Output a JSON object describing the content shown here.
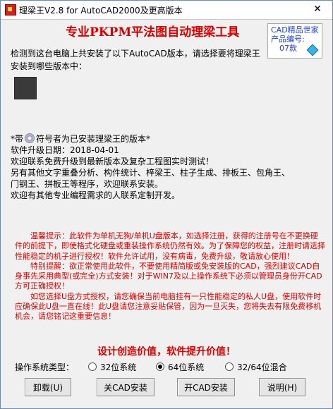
{
  "window": {
    "title": "理梁王V2.8 for AutoCAD2000及更高版本",
    "close_glyph": "✕"
  },
  "header": {
    "headline": "专业PKPM平法图自动理梁工具",
    "product_box": {
      "line1": "CAD精品世家",
      "line2": "产品编号:",
      "line3": "07款"
    }
  },
  "detect": {
    "message": "检测到这台电脑上共安装了以下AutoCAD版本，请选择要将理梁王安装到哪些版本中："
  },
  "info": {
    "installed_note_prefix": "*带",
    "installed_note_suffix": "符号者为已安装理梁王的版本*",
    "upgrade_date": "软件升级日期：2018-04-01",
    "line3": "欢迎联系免费升级到最新版本及复杂工程图实时测试！",
    "line4": "另有其他文字重叠分析、构件统计、梓梁王、柱子生成、排板王、包角王、",
    "line5": "门钢王、拼板王等程序，欢迎联系安装。",
    "line6": "欢迎有其他专业编程需求的人联系定制开发。"
  },
  "notice": {
    "p1": "温馨提示：此软件为单机无狗/单机U盘版本，如选择注册，获得的注册号在不更换硬件的前提下，即使格式化硬盘或重装操作系统仍然有效。为了保障您的权益，注册时请选择性能稳定的机子进行授权！软件允许试用，没有病毒，免费升级，敬请放心使用！",
    "p2": "特别提醒：欲正常使用此软件，不要使用精简版或免安装版的CAD，强烈建议CAD自身事先采用典型(或完全)方式安装！对于WIN7及以上操作系统下必须以管理员身份开CAD方可正确授权！",
    "p3": "如您选择U盘方式授权，请您确保当前电脑挂有一只性能稳定的私人U盘，使用软件时应确保此U盘一直在线！此U盘请您注意妥贴保管，因为一旦灭失，您将失去有限免费移机机会，请您铭记这重要信息！"
  },
  "slogan": "设计创造价值，软件提升价值！",
  "os": {
    "label": "操作系统类型：",
    "options": [
      "32位系统",
      "64位系统",
      "32/64位混合"
    ],
    "selected_index": 1
  },
  "buttons": {
    "uninstall": "卸载(U)",
    "close_cad_install": "关CAD安装",
    "open_cad_install": "开CAD安装",
    "help": "说明(H)"
  },
  "colors": {
    "accent_red": "#d40000",
    "product_blue": "#1f3fbf"
  }
}
